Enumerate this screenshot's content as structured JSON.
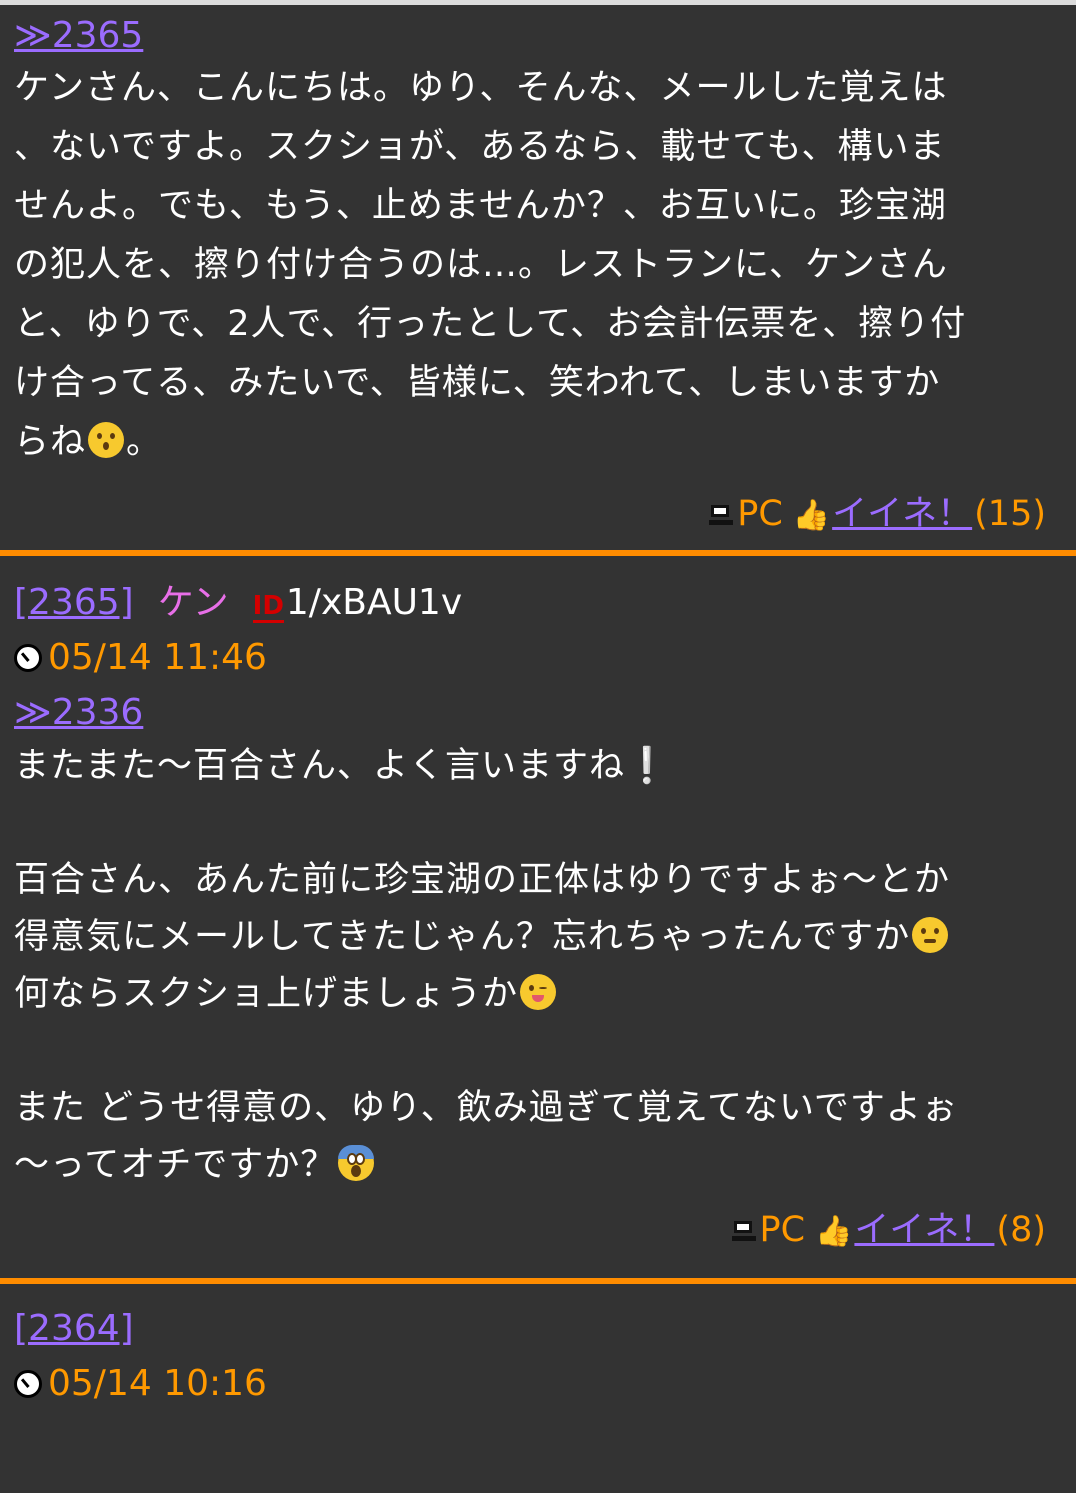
{
  "posts": [
    {
      "reply_link": "≫2365",
      "body_lines": [
        "ケンさん、こんにちは。ゆり、そんな、メールした覚えは",
        "、ないですよ。スクショが、あるなら、載せても、構いま",
        "せんよ。でも、もう、止めませんか？、お互いに。珍宝湖",
        "の犯人を、擦り付け合うのは…。レストランに、ケンさん",
        "と、ゆりで、2人で、行ったとして、お会計伝票を、擦り付",
        "け合ってる、みたいで、皆様に、笑われて、しまいますか"
      ],
      "last_line_pre": "らね",
      "last_line_emoji": "kissing-face-emoji",
      "last_line_post": "。",
      "device": "PC",
      "iine_label": "イイネ！",
      "iine_count": "(15)"
    },
    {
      "number": "[2365]",
      "name": "ケン",
      "id_badge": "ID",
      "user_id": "1/xBAU1v",
      "date": "05/14 11:46",
      "reply_link": "≫2336",
      "line1": "またまた〜百合さん、よく言いますね",
      "line1_mark": "❕",
      "line2": "百合さん、あんた前に珍宝湖の正体はゆりですよぉ〜とか",
      "line3": "得意気にメールしてきたじゃん？忘れちゃったんですか",
      "line3_emoji": "grimacing-face-emoji",
      "line4": "何ならスクショ上げましょうか",
      "line4_emoji": "winking-tongue-face-emoji",
      "line5": "また どうせ得意の、ゆり、飲み過ぎて覚えてないですよぉ",
      "line6": "〜ってオチですか？",
      "line6_emoji": "screaming-face-emoji",
      "device": "PC",
      "iine_label": "イイネ！",
      "iine_count": "(8)"
    },
    {
      "number": "[2364]",
      "date": "05/14 10:16"
    }
  ],
  "colors": {
    "background": "#333333",
    "link": "#9b6cff",
    "accent_orange": "#ff9900",
    "divider": "#ff8c00",
    "name": "#e86fe8",
    "id_badge": "#d40000"
  }
}
